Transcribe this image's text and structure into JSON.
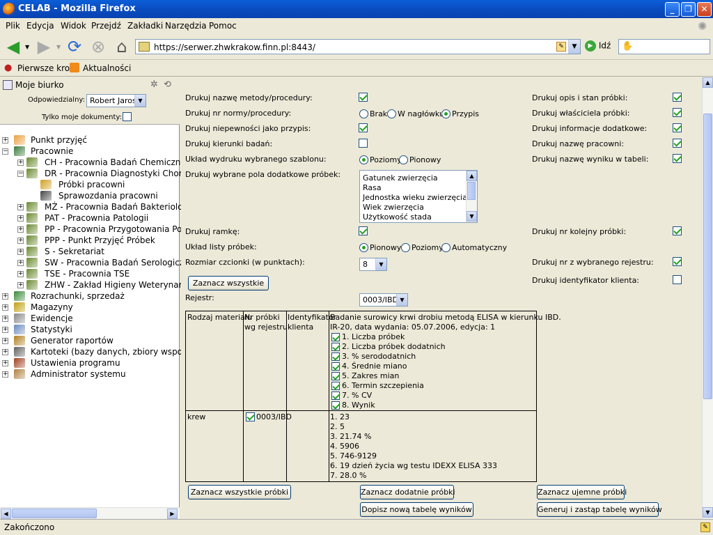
{
  "window": {
    "title": "CELAB - Mozilla Firefox"
  },
  "menu": [
    "Plik",
    "Edycja",
    "Widok",
    "Przejdź",
    "Zakładki",
    "Narzędzia",
    "Pomoc"
  ],
  "nav": {
    "url": "https://serwer.zhwkrakow.finn.pl:8443/",
    "go_label": "Idź"
  },
  "bookmarks": [
    "Pierwsze kroki",
    "Aktualności"
  ],
  "sidebar": {
    "title": "Moje biurko",
    "responsible_label": "Odpowiedzialny:",
    "responsible_value": "Robert Jaros",
    "only_mine_label": "Tylko moje dokumenty:",
    "tree": [
      {
        "label": "Punkt przyjęć",
        "icon": "flask-icon"
      },
      {
        "label": "Pracownie",
        "icon": "lab-icon"
      },
      {
        "label": "CH - Pracownia Badań Chemiczny",
        "icon": "org-icon"
      },
      {
        "label": "DR - Pracownia Diagnostyki Choró",
        "icon": "org-icon"
      },
      {
        "label": "Próbki pracowni",
        "icon": "samples-icon"
      },
      {
        "label": "Sprawozdania pracowni",
        "icon": "report-icon"
      },
      {
        "label": "MŻ - Pracownia Badań Bakteriologi",
        "icon": "org-icon"
      },
      {
        "label": "PAT - Pracownia Patologii",
        "icon": "org-icon"
      },
      {
        "label": "PP - Pracownia Przygotowania Pod",
        "icon": "org-icon"
      },
      {
        "label": "PPP - Punkt Przyjęć Próbek",
        "icon": "org-icon"
      },
      {
        "label": "S - Sekretariat",
        "icon": "org-icon"
      },
      {
        "label": "SW - Pracownia Badań Serologiczr",
        "icon": "org-icon"
      },
      {
        "label": "TSE - Pracownia TSE",
        "icon": "org-icon"
      },
      {
        "label": "ZHW - Zakład Higieny Weterynaryjn",
        "icon": "org-icon"
      },
      {
        "label": "Rozrachunki, sprzedaż",
        "icon": "money-icon"
      },
      {
        "label": "Magazyny",
        "icon": "warehouse-icon"
      },
      {
        "label": "Ewidencje",
        "icon": "records-icon"
      },
      {
        "label": "Statystyki",
        "icon": "stats-icon"
      },
      {
        "label": "Generator raportów",
        "icon": "generator-icon"
      },
      {
        "label": "Kartoteki (bazy danych, zbiory wspoma",
        "icon": "cards-icon"
      },
      {
        "label": "Ustawienia programu",
        "icon": "tools-icon"
      },
      {
        "label": "Administrator systemu",
        "icon": "admin-icon"
      }
    ]
  },
  "form": {
    "print_method": "Drukuj nazwę metody/procedury:",
    "print_norm": "Drukuj nr normy/procedury:",
    "norm_opts": [
      "Brak",
      "W nagłówku",
      "Przypis"
    ],
    "print_uncert": "Drukuj niepewności jako przypis:",
    "print_dirs": "Drukuj kierunki badań:",
    "layout_tpl": "Układ wydruku wybranego szablonu:",
    "layout_opts": [
      "Poziomy",
      "Pionowy"
    ],
    "extra_fields": "Drukuj wybrane pola dodatkowe próbek:",
    "extra_list": [
      "Gatunek zwierzęcia",
      "Rasa",
      "Jednostka wieku zwierzęcia",
      "Wiek zwierzęcia",
      "Użytkowość stada"
    ],
    "print_frame": "Drukuj ramkę:",
    "list_layout": "Układ listy próbek:",
    "list_opts": [
      "Pionowy",
      "Poziomy",
      "Automatyczny"
    ],
    "font_size": "Rozmiar czcionki (w punktach):",
    "font_value": "8",
    "select_all": "Zaznacz wszystkie",
    "register": "Rejestr:",
    "register_value": "0003/IBD",
    "right": {
      "desc": "Drukuj opis i stan próbki:",
      "owner": "Drukuj właściciela próbki:",
      "info": "Drukuj informacje dodatkowe:",
      "lab": "Drukuj nazwę pracowni:",
      "result_name": "Drukuj nazwę wyniku w tabeli:",
      "seq": "Drukuj nr kolejny próbki:",
      "reg_nr": "Drukuj nr z wybranego rejestru:",
      "client_id": "Drukuj identyfikator klienta:"
    }
  },
  "table": {
    "h1": "Rodzaj materiału",
    "h2a": "Nr próbki",
    "h2b": "wg rejestru",
    "h3a": "Identyfikator",
    "h3b": "klienta",
    "h4a": "Badanie surowicy krwi drobiu metodą ELISA w kierunku IBD.",
    "h4b": "IR-20, data wydania: 05.07.2006, edycja: 1",
    "params": [
      "1. Liczba próbek",
      "2. Liczba próbek dodatnich",
      "3. % serododatnich",
      "4. Średnie miano",
      "5. Zakres mian",
      "6. Termin szczepienia",
      "7. % CV",
      "8. Wynik"
    ],
    "row": {
      "material": "krew",
      "sample": "0003/IBD",
      "results": [
        "1. 23",
        "2. 5",
        "3. 21.74 %",
        "4. 5906",
        "5. 746-9129",
        "6. 19 dzień życia wg testu IDEXX ELISA 333",
        "7. 28.0 %"
      ]
    }
  },
  "buttons": {
    "all_samples": "Zaznacz wszystkie próbki",
    "positive": "Zaznacz dodatnie próbki",
    "negative": "Zaznacz ujemne próbki",
    "add_table": "Dopisz nową tabelę wyników",
    "gen_table": "Generuj i zastąp tabelę wyników"
  },
  "status": "Zakończono"
}
